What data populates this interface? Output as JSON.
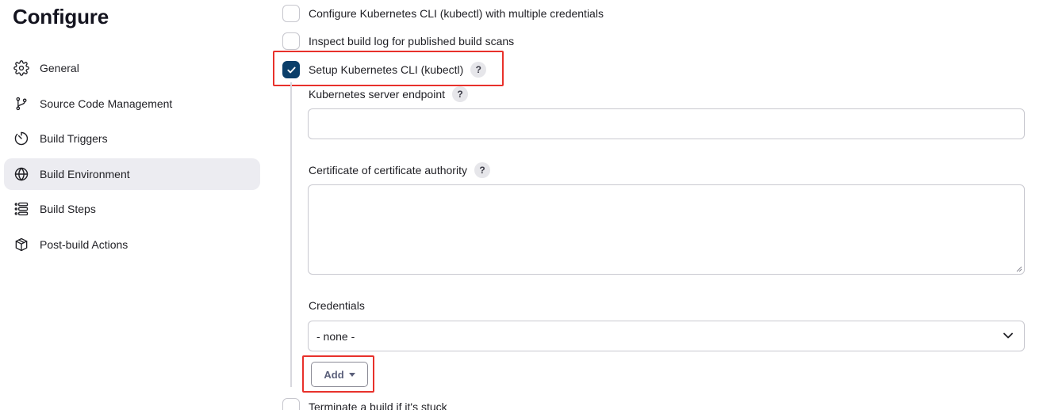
{
  "page": {
    "title": "Configure"
  },
  "sidebar": {
    "items": [
      {
        "label": "General",
        "icon": "gear-icon",
        "active": false
      },
      {
        "label": "Source Code Management",
        "icon": "branch-icon",
        "active": false
      },
      {
        "label": "Build Triggers",
        "icon": "timer-icon",
        "active": false
      },
      {
        "label": "Build Environment",
        "icon": "globe-icon",
        "active": true
      },
      {
        "label": "Build Steps",
        "icon": "list-icon",
        "active": false
      },
      {
        "label": "Post-build Actions",
        "icon": "package-icon",
        "active": false
      }
    ]
  },
  "options": {
    "kubectl_multi": {
      "label": "Configure Kubernetes CLI (kubectl) with multiple credentials",
      "checked": false
    },
    "inspect_log": {
      "label": "Inspect build log for published build scans",
      "checked": false
    },
    "setup_kubectl": {
      "label": "Setup Kubernetes CLI (kubectl)",
      "checked": true,
      "help": "?"
    },
    "terminate": {
      "label": "Terminate a build if it's stuck",
      "checked": false
    }
  },
  "form": {
    "server_endpoint": {
      "label": "Kubernetes server endpoint",
      "help": "?",
      "value": "",
      "placeholder": ""
    },
    "ca_cert": {
      "label": "Certificate of certificate authority",
      "help": "?",
      "value": ""
    },
    "credentials": {
      "label": "Credentials",
      "selected": "- none -"
    },
    "add_button": {
      "label": "Add"
    }
  },
  "colors": {
    "accent": "#0b3f6a",
    "highlight": "#e8312b",
    "active_nav_bg": "#ececf1"
  }
}
